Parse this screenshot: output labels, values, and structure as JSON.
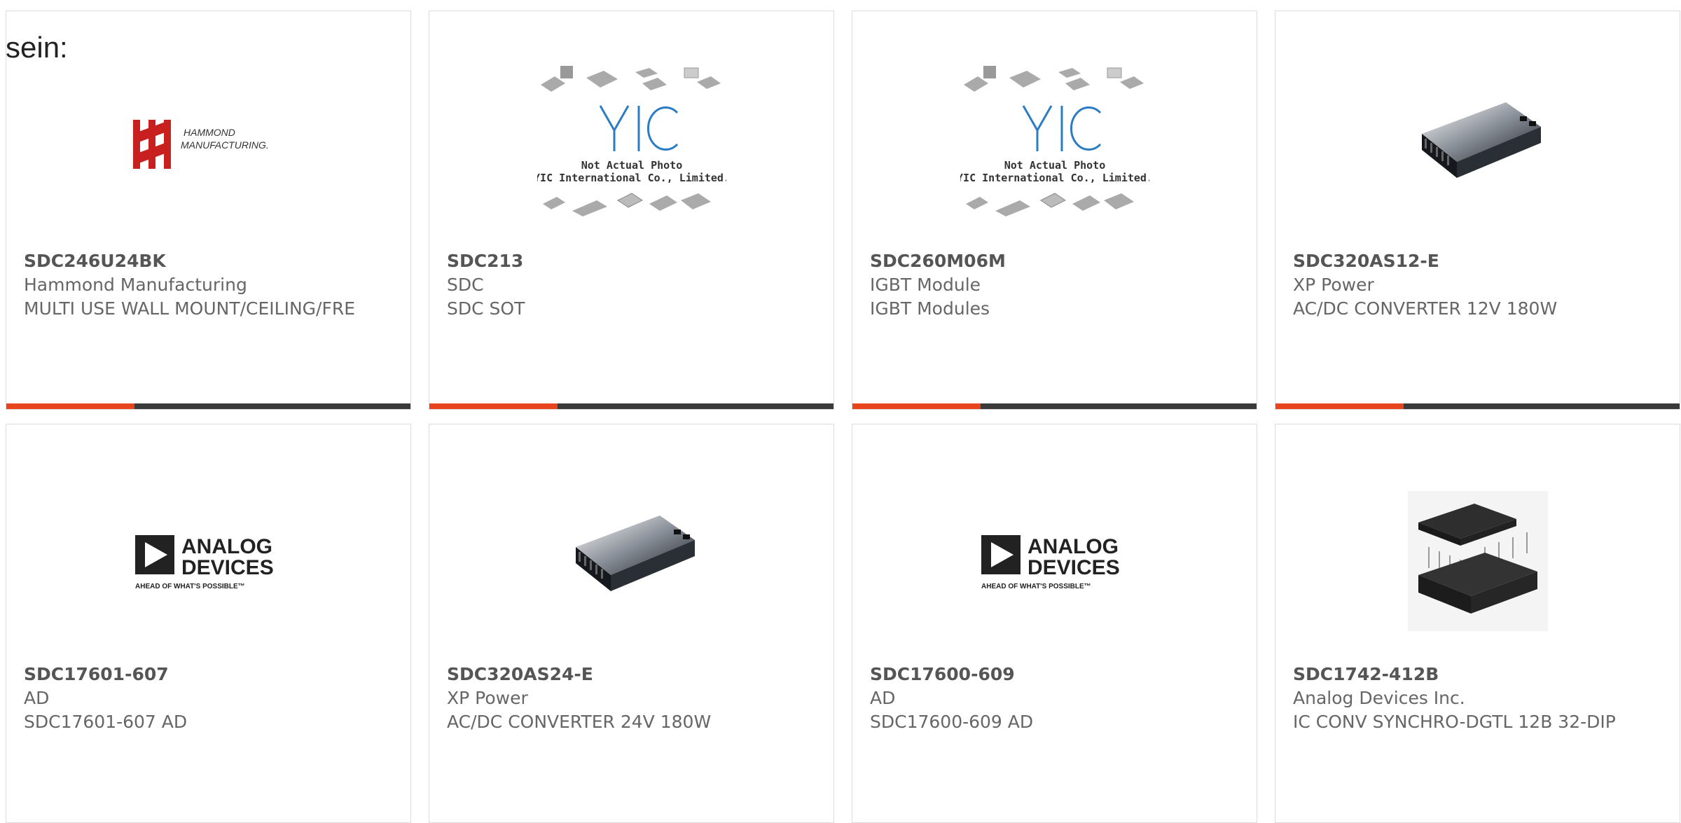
{
  "lead_text": "sein:",
  "colors": {
    "accent": "#e8451e",
    "bar": "#3a3a3a",
    "border": "#dcdcdc"
  },
  "products": [
    {
      "part": "SDC246U24BK",
      "maker": "Hammond Manufacturing",
      "desc": "MULTI USE WALL MOUNT/CEILING/FRE",
      "image": "hammond-logo",
      "logo_text": [
        "HAMMOND",
        "MANUFACTURING."
      ]
    },
    {
      "part": "SDC213",
      "maker": "SDC",
      "desc": "SDC SOT",
      "image": "yic-placeholder",
      "logo_text": [
        "YIC",
        "Not Actual Photo",
        "YIC International Co., Limited."
      ]
    },
    {
      "part": "SDC260M06M",
      "maker": "IGBT Module",
      "desc": "IGBT Modules",
      "image": "yic-placeholder",
      "logo_text": [
        "YIC",
        "Not Actual Photo",
        "YIC International Co., Limited."
      ]
    },
    {
      "part": "SDC320AS12-E",
      "maker": "XP Power",
      "desc": "AC/DC CONVERTER 12V 180W",
      "image": "power-module"
    },
    {
      "part": "SDC17601-607",
      "maker": "AD",
      "desc": "SDC17601-607 AD",
      "image": "analog-devices-logo",
      "logo_text": [
        "ANALOG",
        "DEVICES",
        "AHEAD OF WHAT'S POSSIBLE™"
      ]
    },
    {
      "part": "SDC320AS24-E",
      "maker": "XP Power",
      "desc": "AC/DC CONVERTER 24V 180W",
      "image": "power-module"
    },
    {
      "part": "SDC17600-609",
      "maker": "AD",
      "desc": "SDC17600-609 AD",
      "image": "analog-devices-logo",
      "logo_text": [
        "ANALOG",
        "DEVICES",
        "AHEAD OF WHAT'S POSSIBLE™"
      ]
    },
    {
      "part": "SDC1742-412B",
      "maker": "Analog Devices Inc.",
      "desc": "IC CONV SYNCHRO-DGTL 12B 32-DIP",
      "image": "dip-module"
    }
  ]
}
